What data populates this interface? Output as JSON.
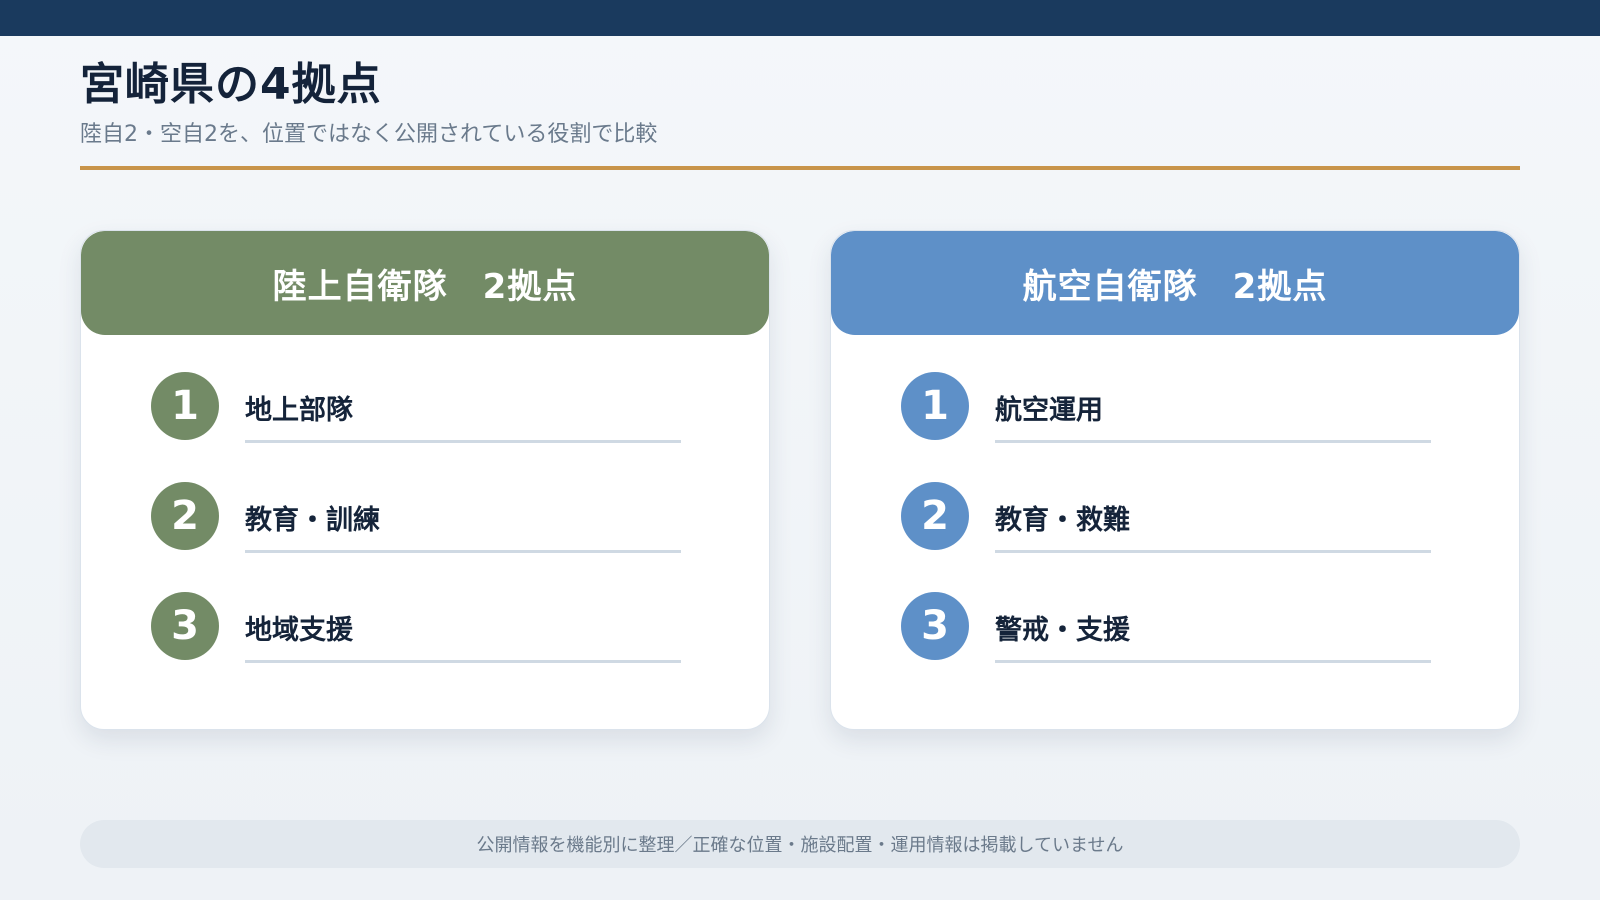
{
  "header": {
    "title": "宮崎県の4拠点",
    "subtitle": "陸自2・空自2を、位置ではなく公開されている役割で比較"
  },
  "cards": [
    {
      "title": "陸上自衛隊　2拠点",
      "color": "#738b66",
      "items": [
        {
          "number": "1",
          "label": "地上部隊"
        },
        {
          "number": "2",
          "label": "教育・訓練"
        },
        {
          "number": "3",
          "label": "地域支援"
        }
      ]
    },
    {
      "title": "航空自衛隊　2拠点",
      "color": "#5e90c8",
      "items": [
        {
          "number": "1",
          "label": "航空運用"
        },
        {
          "number": "2",
          "label": "教育・救難"
        },
        {
          "number": "3",
          "label": "警戒・支援"
        }
      ]
    }
  ],
  "footer": {
    "note": "公開情報を機能別に整理／正確な位置・施設配置・運用情報は掲載していません"
  },
  "colors": {
    "top_bar": "#1a3a5e",
    "accent_divider": "#c8944a"
  }
}
